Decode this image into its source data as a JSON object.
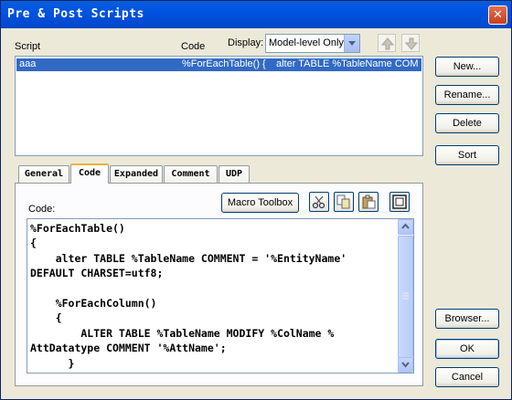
{
  "window": {
    "title": "Pre & Post Scripts",
    "close_glyph": "✕"
  },
  "labels": {
    "script": "Script",
    "code": "Code",
    "display": "Display:",
    "code_editor": "Code:"
  },
  "display_select": {
    "value": "Model-level Only"
  },
  "scripts_list": [
    {
      "name": "aaa",
      "code_start": "%ForEachTable() {",
      "code_rest": "alter TABLE %TableName COM"
    }
  ],
  "buttons": {
    "new": "New...",
    "rename": "Rename...",
    "delete": "Delete",
    "sort": "Sort",
    "browser": "Browser...",
    "ok": "OK",
    "cancel": "Cancel",
    "macro_toolbox": "Macro Toolbox"
  },
  "tabs": [
    {
      "label": "General",
      "active": false
    },
    {
      "label": "Code",
      "active": true
    },
    {
      "label": "Expanded",
      "active": false
    },
    {
      "label": "Comment",
      "active": false
    },
    {
      "label": "UDP",
      "active": false
    }
  ],
  "editor": {
    "code": "%ForEachTable()\n{\n    alter TABLE %TableName COMMENT = '%EntityName'\nDEFAULT CHARSET=utf8;\n\n    %ForEachColumn()\n    {\n        ALTER TABLE %TableName MODIFY %ColName %\nAttDatatype COMMENT '%AttName';\n      }"
  },
  "icons": [
    "close-icon",
    "move-up-icon",
    "move-down-icon",
    "chevron-down-icon",
    "cut-icon",
    "copy-icon",
    "paste-icon",
    "expand-editor-icon",
    "scroll-up-icon",
    "scroll-down-icon"
  ],
  "colors": {
    "titlebar": "#0055e5",
    "selection": "#316ac5",
    "dialog": "#ece9d8",
    "active_tab_accent": "#f1b330"
  }
}
